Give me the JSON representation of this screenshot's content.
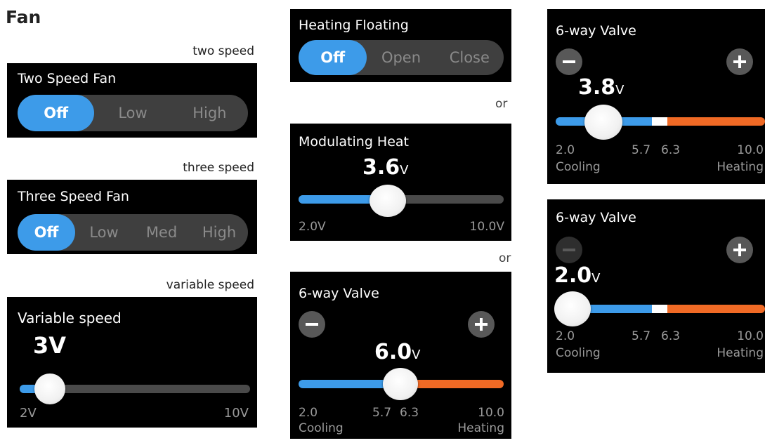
{
  "page": {
    "title": "Fan",
    "or_label": "or"
  },
  "two_speed": {
    "caption": "two speed",
    "title": "Two Speed Fan",
    "options": [
      "Off",
      "Low",
      "High"
    ],
    "selected": "Off"
  },
  "three_speed": {
    "caption": "three speed",
    "title": "Three Speed Fan",
    "options": [
      "Off",
      "Low",
      "Med",
      "High"
    ],
    "selected": "Off"
  },
  "variable_speed": {
    "caption": "variable speed",
    "title": "Variable speed",
    "value": "3V",
    "min_label": "2V",
    "max_label": "10V"
  },
  "heating_floating": {
    "title": "Heating Floating",
    "options": [
      "Off",
      "Open",
      "Close"
    ],
    "selected": "Off"
  },
  "modulating_heat": {
    "title": "Modulating Heat",
    "value": "3.6",
    "unit": "V",
    "min_label": "2.0V",
    "max_label": "10.0V"
  },
  "valve_mid": {
    "title": "6-way Valve",
    "value": "6.0",
    "unit": "V",
    "scale": [
      "2.0",
      "5.7",
      "6.3",
      "10.0"
    ],
    "left_label": "Cooling",
    "right_label": "Heating"
  },
  "valve_top": {
    "title": "6-way Valve",
    "value": "3.8",
    "unit": "V",
    "scale": [
      "2.0",
      "5.7",
      "6.3",
      "10.0"
    ],
    "left_label": "Cooling",
    "right_label": "Heating"
  },
  "valve_bottom": {
    "title": "6-way Valve",
    "value": "2.0",
    "unit": "V",
    "scale": [
      "2.0",
      "5.7",
      "6.3",
      "10.0"
    ],
    "left_label": "Cooling",
    "right_label": "Heating",
    "minus_disabled": true
  },
  "colors": {
    "cooling": "#3d9be9",
    "heating": "#f06a25",
    "neutral": "#ffffff",
    "track": "#4a4a4a"
  }
}
